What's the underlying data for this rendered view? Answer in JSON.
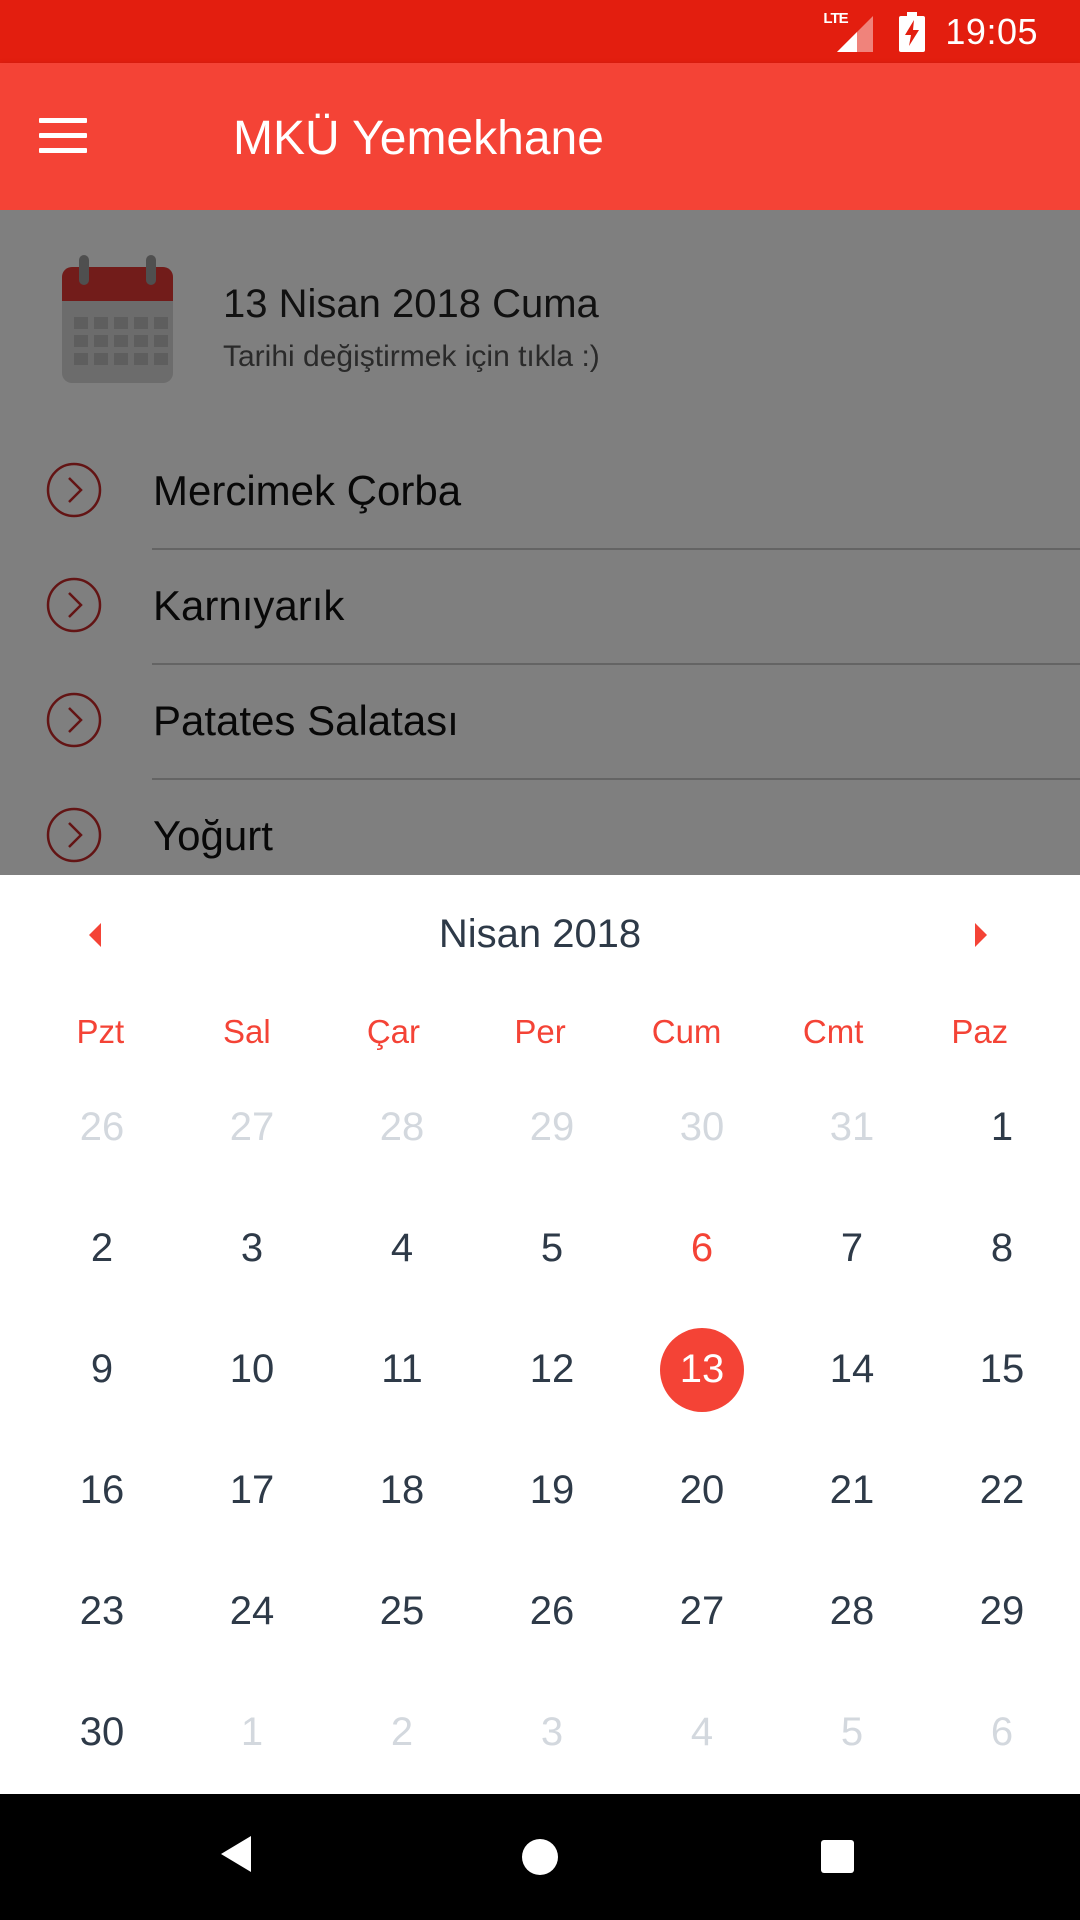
{
  "status_bar": {
    "network_label": "LTE",
    "time": "19:05",
    "icons": [
      "lte-signal-icon",
      "battery-charging-icon"
    ]
  },
  "app_bar": {
    "title": "MKÜ Yemekhane",
    "menu_icon": "hamburger-menu-icon"
  },
  "date_header": {
    "date": "13 Nisan 2018 Cuma",
    "hint": "Tarihi değiştirmek için tıkla :)",
    "icon": "calendar-icon"
  },
  "menu_items": [
    {
      "label": "Mercimek Çorba"
    },
    {
      "label": "Karnıyarık"
    },
    {
      "label": "Patates Salatası"
    },
    {
      "label": "Yoğurt"
    }
  ],
  "calendar": {
    "month_title": "Nisan 2018",
    "weekdays": [
      "Pzt",
      "Sal",
      "Çar",
      "Per",
      "Cum",
      "Cmt",
      "Paz"
    ],
    "selected_day": "13",
    "days": [
      {
        "label": "26",
        "muted": true
      },
      {
        "label": "27",
        "muted": true
      },
      {
        "label": "28",
        "muted": true
      },
      {
        "label": "29",
        "muted": true
      },
      {
        "label": "30",
        "muted": true
      },
      {
        "label": "31",
        "muted": true
      },
      {
        "label": "1"
      },
      {
        "label": "2"
      },
      {
        "label": "3"
      },
      {
        "label": "4"
      },
      {
        "label": "5"
      },
      {
        "label": "6",
        "holiday": true
      },
      {
        "label": "7"
      },
      {
        "label": "8"
      },
      {
        "label": "9"
      },
      {
        "label": "10"
      },
      {
        "label": "11"
      },
      {
        "label": "12"
      },
      {
        "label": "13",
        "selected": true
      },
      {
        "label": "14"
      },
      {
        "label": "15"
      },
      {
        "label": "16"
      },
      {
        "label": "17"
      },
      {
        "label": "18"
      },
      {
        "label": "19"
      },
      {
        "label": "20"
      },
      {
        "label": "21"
      },
      {
        "label": "22"
      },
      {
        "label": "23"
      },
      {
        "label": "24"
      },
      {
        "label": "25"
      },
      {
        "label": "26"
      },
      {
        "label": "27"
      },
      {
        "label": "28"
      },
      {
        "label": "29"
      },
      {
        "label": "30"
      },
      {
        "label": "1",
        "muted": true
      },
      {
        "label": "2",
        "muted": true
      },
      {
        "label": "3",
        "muted": true
      },
      {
        "label": "4",
        "muted": true
      },
      {
        "label": "5",
        "muted": true
      },
      {
        "label": "6",
        "muted": true
      }
    ]
  },
  "colors": {
    "status_bar": "#e31e0f",
    "app_bar": "#f44336",
    "accent": "#f44336",
    "day_text": "#2e3a48",
    "muted_day": "#d3d8de",
    "meal_arrow": "#c62828"
  },
  "nav_bar": {
    "icons": [
      "back-icon",
      "home-icon",
      "recent-apps-icon"
    ]
  }
}
